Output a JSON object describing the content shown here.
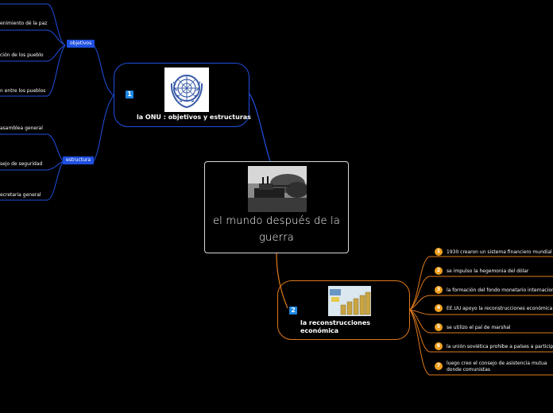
{
  "central": {
    "title": "el mundo después de la guerra"
  },
  "topics": [
    {
      "badge": "1",
      "label": "la ONU : objetivos y estructuras",
      "image": "un-emblem",
      "subtopics": [
        {
          "label": "objetivos",
          "leaves": [
            "",
            "enimiento dé la paz",
            "ción de los pueblo",
            "n entre los pueblos"
          ]
        },
        {
          "label": "estructura",
          "leaves": [
            "asamblea general",
            "sejo de seguridad",
            "ecretaria general"
          ]
        }
      ]
    },
    {
      "badge": "2",
      "label": "la reconstrucciones económica",
      "image": "money-stacks",
      "items": [
        {
          "num": "1",
          "text": "1930 crearon un sistema financiero mundial"
        },
        {
          "num": "2",
          "text": "se impulso la hegemonia del dólar"
        },
        {
          "num": "3",
          "text": "la formación del fondo monetario internacional"
        },
        {
          "num": "4",
          "text": "EE.UU apoyo la reconstrucciones económica de l"
        },
        {
          "num": "5",
          "text": "se utilizo el pal de marshal"
        },
        {
          "num": "6",
          "text": "la unión soviética prohibe a países a participar"
        },
        {
          "num": "7",
          "text": "luego creo el consejo de asistencia mutua donde comunistas"
        }
      ]
    }
  ],
  "colors": {
    "blue": "#1f4fe0",
    "orange": "#e07a1a",
    "badge": "#1e88e5"
  }
}
